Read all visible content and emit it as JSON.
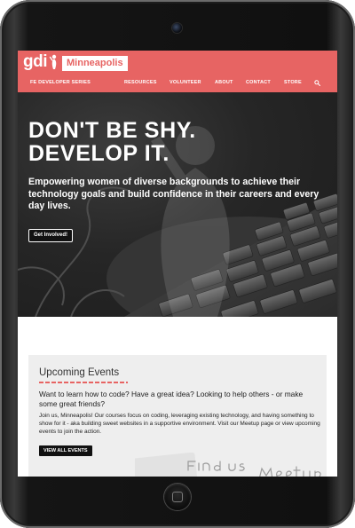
{
  "brand": {
    "logo_text": "gdi",
    "city": "Minneapolis",
    "accent_color": "#e76463"
  },
  "nav": {
    "items": [
      {
        "label": "FE DEVELOPER SERIES"
      },
      {
        "label": "RESOURCES"
      },
      {
        "label": "VOLUNTEER"
      },
      {
        "label": "ABOUT"
      },
      {
        "label": "CONTACT"
      },
      {
        "label": "STORE"
      }
    ],
    "search_icon": "search-icon"
  },
  "hero": {
    "title_line1": "DON'T BE SHY.",
    "title_line2": "DEVELOP IT.",
    "subtitle": "Empowering women of diverse backgrounds to achieve their technology goals and build confidence in their careers and every day lives.",
    "cta_label": "Get Involved!"
  },
  "events": {
    "heading": "Upcoming Events",
    "question": "Want to learn how to code? Have a great idea? Looking to help others - or make some great friends?",
    "paragraph": "Join us, Minneapolis! Our courses focus on coding, leveraging existing technology, and having something to show for it - aka building sweet websites in a supportive environment. Visit our Meetup page or view upcoming events to join the action.",
    "button_label": "VIEW ALL EVENTS",
    "sketch_text": "Find us ... Meetup"
  }
}
